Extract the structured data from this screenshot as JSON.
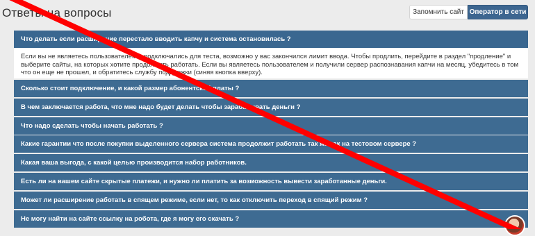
{
  "page": {
    "title": "Ответы на вопросы"
  },
  "header_buttons": {
    "remember": "Запомнить сайт",
    "operator": "Оператор в сети"
  },
  "faq": {
    "open_question": "Что делать если расширение перестало вводить капчу и система остановилась ?",
    "open_answer": "Если вы не являетесь пользователем и подключались для теста, возможно у вас закончился лимит ввода. Чтобы продлить, перейдите в раздел \"продление\" и выберите сайты, на которых хотите продолжить работать. Если вы являетесь пользователем и получили сервер распознавания капчи на месяц, убедитесь в том что он еще не прошел, и обратитесь службу поддержки (синяя кнопка вверху).",
    "questions": [
      "Сколько стоит подключение, и какой размер абонентской платы ?",
      "В чем заключается работа, что мне надо будет делать чтобы зарабатывать деньги ?",
      "Что надо сделать чтобы начать работать ?",
      "Какие гарантии что после покупки выделенного сервера система продолжит работать так же как на тестовом сервере ?",
      "Какая ваша выгода, с какой целью производится набор работников.",
      "Есть ли на вашем сайте скрытые платежи, и нужно ли платить за возможность вывести заработанные деньги.",
      "Может ли расширение работать в спящем режиме, если нет, то как отключить переход в спящий режим ?",
      "Не могу найти на сайте ссылку на робота, где я могу его скачать ?"
    ]
  },
  "colors": {
    "question_bg": "#3e6b92",
    "operator_bg": "#3d6690",
    "overlay_line": "#ff0000"
  }
}
